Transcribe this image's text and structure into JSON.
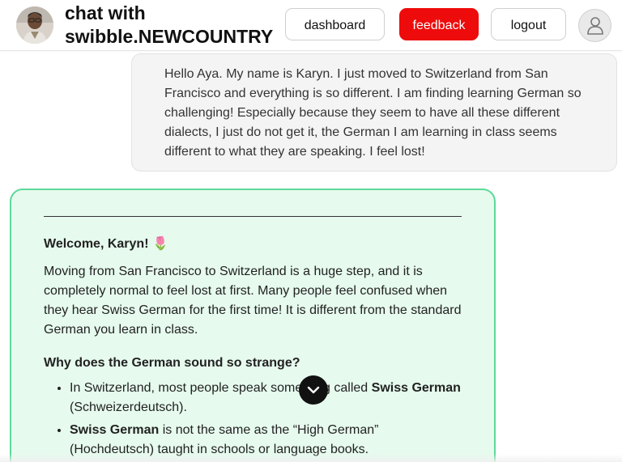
{
  "header": {
    "title_line1": "chat with",
    "title_line2": "swibble.NEWCOUNTRY",
    "buttons": {
      "dashboard": "dashboard",
      "feedback": "feedback",
      "logout": "logout"
    },
    "icons": {
      "avatar": "assistant-avatar-photo",
      "user": "user-icon"
    },
    "colors": {
      "feedback_bg": "#ee0b0b"
    }
  },
  "messages": {
    "user": {
      "text": "Hello Aya. My name is Karyn. I just moved to Switzerland from San Francisco and everything is so different. I am finding learning German so challenging! Especially because they seem to have all these different dialects, I just do not get it, the German I am learning in class seems different to what they are speaking. I feel lost!"
    },
    "assistant": {
      "welcome": "Welcome, Karyn! 🌷",
      "intro": "Moving from San Francisco to Switzerland is a huge step, and it is completely normal to feel lost at first. Many people feel confused when they hear Swiss German for the first time! It is different from the standard German you learn in class.",
      "subheading": "Why does the German sound so strange?",
      "bullets": [
        {
          "before": "In Switzerland, most people speak something called ",
          "bold": "Swiss German",
          "after": " (Schweizerdeutsch)."
        },
        {
          "before": "",
          "bold": "Swiss German",
          "after": " is not the same as the “High German” (Hochdeutsch) taught in schools or language books."
        }
      ],
      "colors": {
        "background": "#e6faee",
        "border": "#5ed99a"
      }
    }
  },
  "scroll_button": {
    "icon": "chevron-down-icon"
  }
}
